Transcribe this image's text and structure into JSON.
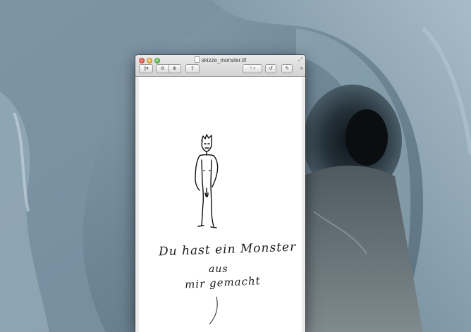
{
  "window": {
    "title": "skizze_monster.tif",
    "icons": {
      "close": "close-button",
      "minimize": "minimize-button",
      "zoom": "zoom-button",
      "fullscreen": "fullscreen-icon",
      "document": "document-icon"
    }
  },
  "toolbar": {
    "sidebar_label": "▯▾",
    "zoom_out_label": "⊖",
    "zoom_in_label": "⊕",
    "share_label": "⇪",
    "annotate_label": "✎▾",
    "rotate_label": "↺",
    "edit_label": "✎",
    "more_label": "»"
  },
  "document": {
    "handwriting_line1": "Du hast ein Monster",
    "handwriting_line2": "aus",
    "handwriting_line3": "mir gemacht"
  },
  "colors": {
    "page": "#ffffff",
    "window_chrome": "#ececec",
    "ice_wallpaper": "#6f8594"
  }
}
